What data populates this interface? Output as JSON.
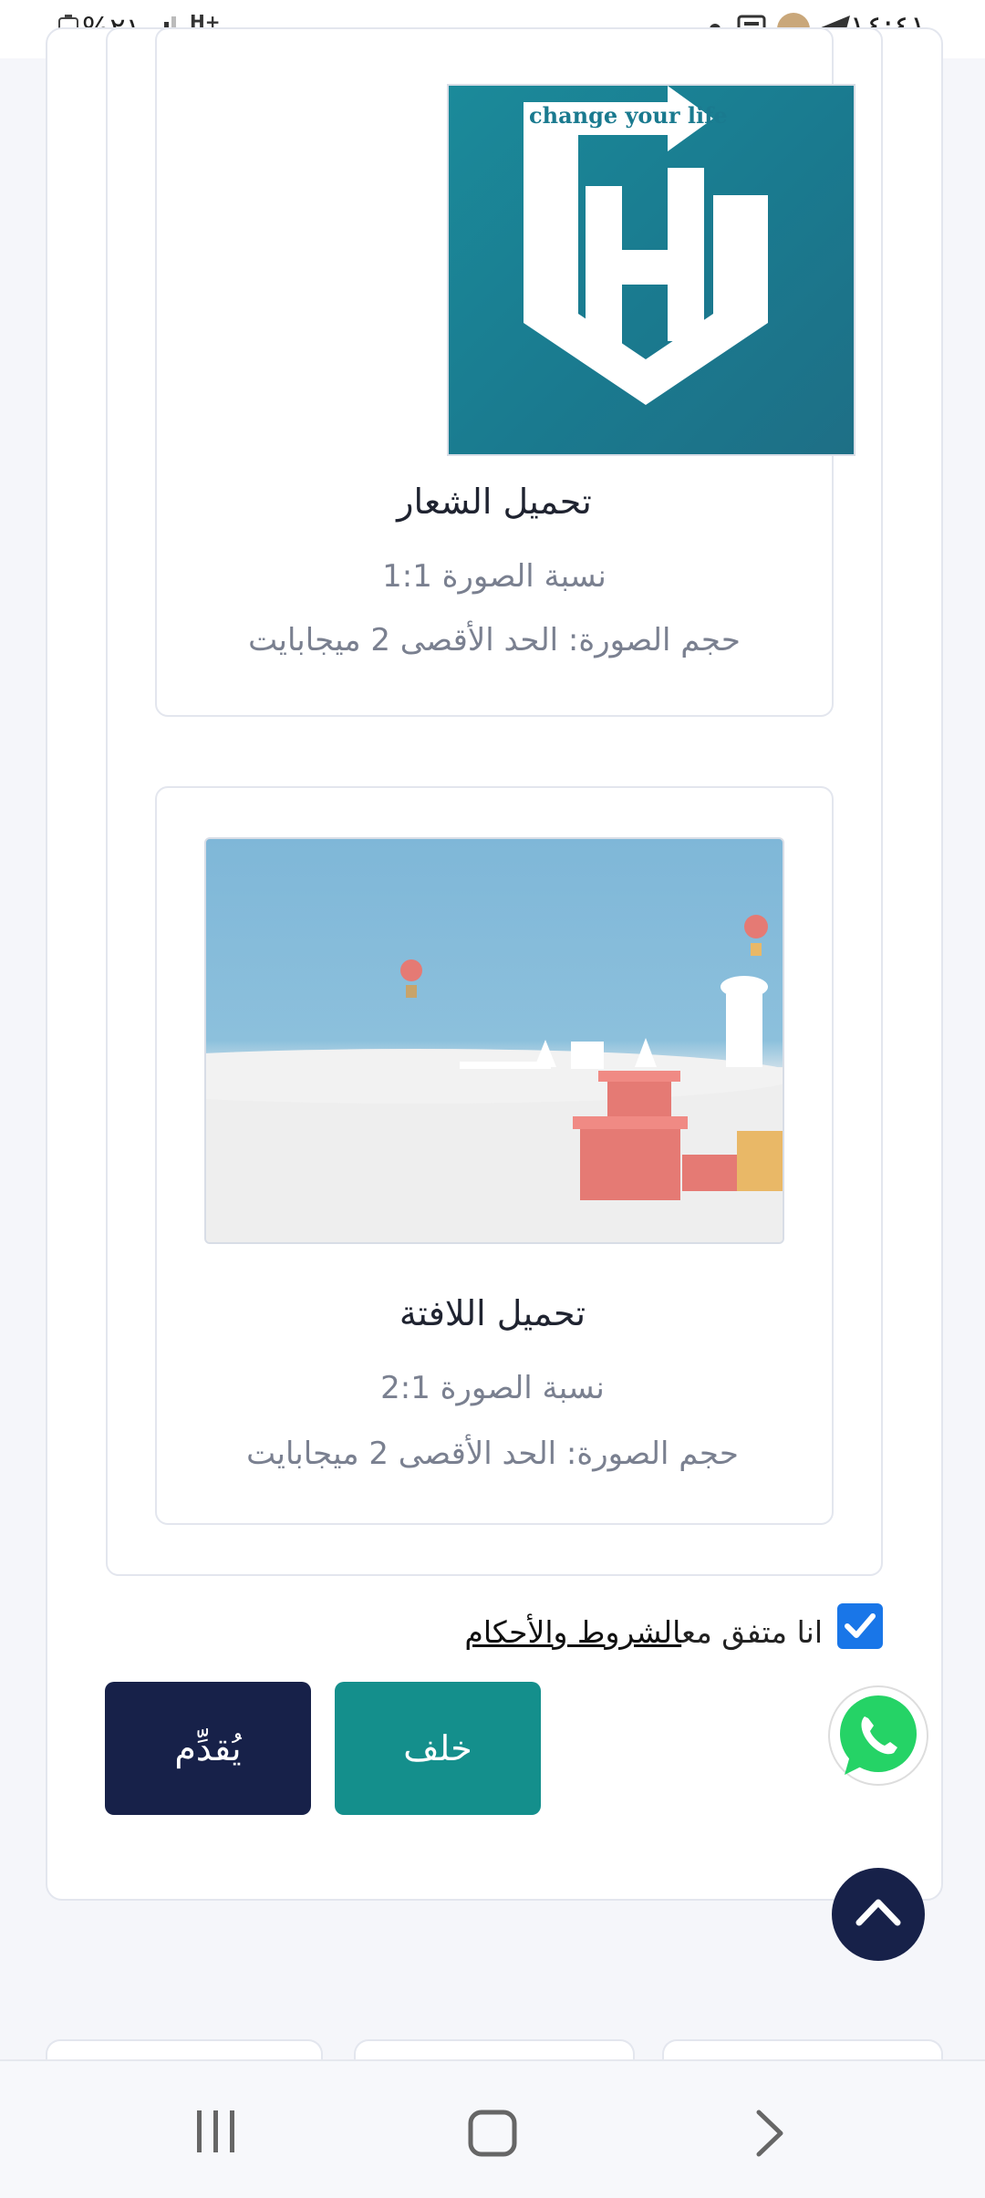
{
  "status_bar": {
    "time": "١٤:٤١",
    "battery": "%٢١",
    "network": "H+",
    "icons": [
      "telegram-icon",
      "avatar",
      "news-icon",
      "notification-dot",
      "signal-icon",
      "battery-icon"
    ]
  },
  "upload_logo": {
    "logo_text": "change your life",
    "title": "تحميل الشعار",
    "ratio": "نسبة الصورة 1:1",
    "size": "حجم الصورة: الحد الأقصى 2 ميجابايت"
  },
  "upload_banner": {
    "title": "تحميل اللافتة",
    "ratio": "نسبة الصورة 2:1",
    "size": "حجم الصورة: الحد الأقصى 2 ميجابايت"
  },
  "terms": {
    "prefix": "انا متفق مع",
    "link": "الشروط والأحكام",
    "checked": true
  },
  "buttons": {
    "next": "يُقدِّم",
    "back": "خلف"
  },
  "colors": {
    "primary_dark": "#172149",
    "teal": "#148f8c",
    "checkbox": "#1976e8",
    "whatsapp": "#25d366"
  },
  "nav": [
    "recent-apps-icon",
    "home-icon",
    "back-icon"
  ]
}
